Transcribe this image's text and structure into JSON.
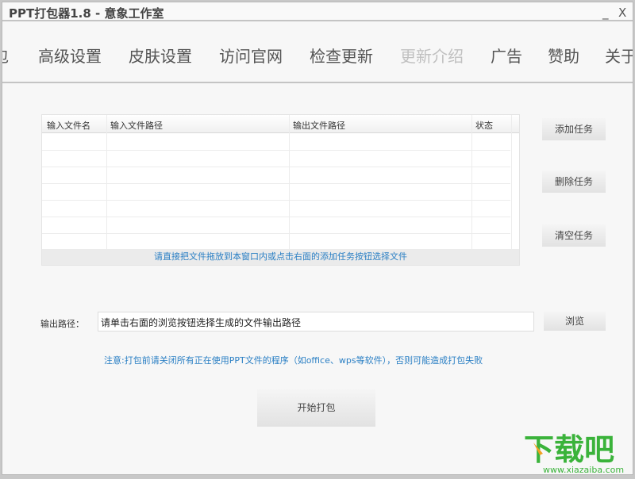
{
  "window": {
    "title": "PPT打包器1.8 - 意象工作室",
    "minimize": "_",
    "close": "X"
  },
  "nav": [
    {
      "label": "包"
    },
    {
      "label": "高级设置"
    },
    {
      "label": "皮肤设置"
    },
    {
      "label": "访问官网"
    },
    {
      "label": "检查更新"
    },
    {
      "label": "更新介绍"
    },
    {
      "label": "广告"
    },
    {
      "label": "赞助"
    },
    {
      "label": "关于"
    }
  ],
  "table": {
    "columns": [
      "输入文件名",
      "输入文件路径",
      "输出文件路径",
      "状态"
    ],
    "rows": [],
    "hint": "请直接把文件拖放到本窗口内或点击右面的添加任务按钮选择文件"
  },
  "buttons": {
    "add": "添加任务",
    "delete": "删除任务",
    "clear": "清空任务",
    "browse": "浏览",
    "start": "开始打包"
  },
  "output": {
    "label": "输出路径：",
    "value": "请单击右面的浏览按钮选择生成的文件输出路径"
  },
  "note": "注意:打包前请关闭所有正在使用PPT文件的程序（如office、wps等软件），否则可能造成打包失败",
  "watermark": {
    "text": "下载吧",
    "url": "www.xiazaiba.com"
  }
}
